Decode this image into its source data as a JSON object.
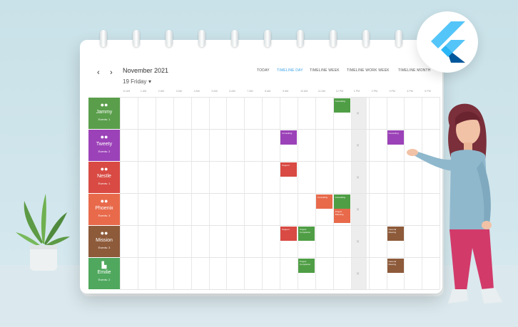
{
  "calendar": {
    "month_label": "November 2021",
    "day_label": "19 Friday",
    "nav_prev": "‹",
    "nav_next": "›",
    "views": [
      {
        "label": "TODAY",
        "active": false
      },
      {
        "label": "TIMELINE DAY",
        "active": true
      },
      {
        "label": "TIMELINE WEEK",
        "active": false
      },
      {
        "label": "TIMELINE WORK WEEK",
        "active": false
      },
      {
        "label": "TIMELINE MONTH",
        "active": false
      }
    ],
    "hours": [
      "12 AM",
      "1 AM",
      "2 AM",
      "3 AM",
      "4 AM",
      "5 AM",
      "6 AM",
      "7 AM",
      "8 AM",
      "9 AM",
      "10 AM",
      "11 AM",
      "12 PM",
      "1 PM",
      "2 PM",
      "3 PM",
      "4 PM",
      "5 PM"
    ],
    "resources": [
      {
        "name": "Jammy",
        "events": "Events: 1",
        "color": "#5a9e4b",
        "icon": "person-group-icon"
      },
      {
        "name": "Tweety",
        "events": "Events: 2",
        "color": "#9c42b8",
        "icon": "person-group-icon"
      },
      {
        "name": "Nestle",
        "events": "Events: 1",
        "color": "#d84a43",
        "icon": "person-group-icon"
      },
      {
        "name": "Phoenix",
        "events": "Events: 3",
        "color": "#e86a4b",
        "icon": "person-group-icon"
      },
      {
        "name": "Mission",
        "events": "Events: 3",
        "color": "#8d5a3a",
        "icon": "person-group-icon"
      },
      {
        "name": "Emilie",
        "events": "Events: 2",
        "color": "#4fa85e",
        "icon": "building-icon"
      }
    ],
    "appointments": [
      {
        "row": 0,
        "col": 12,
        "color": "#4f9e45",
        "label": "Consulting"
      },
      {
        "row": 1,
        "col": 9,
        "color": "#9c42b8",
        "label": "Consulting"
      },
      {
        "row": 1,
        "col": 15,
        "color": "#9c42b8",
        "label": "Consulting"
      },
      {
        "row": 2,
        "col": 9,
        "color": "#d84a43",
        "label": "Support"
      },
      {
        "row": 3,
        "col": 11,
        "color": "#e86a4b",
        "label": "Consulting"
      },
      {
        "row": 3,
        "col": 12,
        "color": "#4f9e45",
        "label": "Consulting"
      },
      {
        "row": 3,
        "col": 12,
        "offset": 1,
        "color": "#e86a4b",
        "label": "Project Planning"
      },
      {
        "row": 4,
        "col": 9,
        "color": "#d84a43",
        "label": "Support"
      },
      {
        "row": 4,
        "col": 10,
        "color": "#4f9e45",
        "label": "Project Completion"
      },
      {
        "row": 4,
        "col": 15,
        "color": "#8d5a3a",
        "label": "General Meeting"
      },
      {
        "row": 5,
        "col": 10,
        "color": "#4f9e45",
        "label": "Project Completion"
      },
      {
        "row": 5,
        "col": 15,
        "color": "#8d5a3a",
        "label": "General Meeting"
      }
    ]
  }
}
